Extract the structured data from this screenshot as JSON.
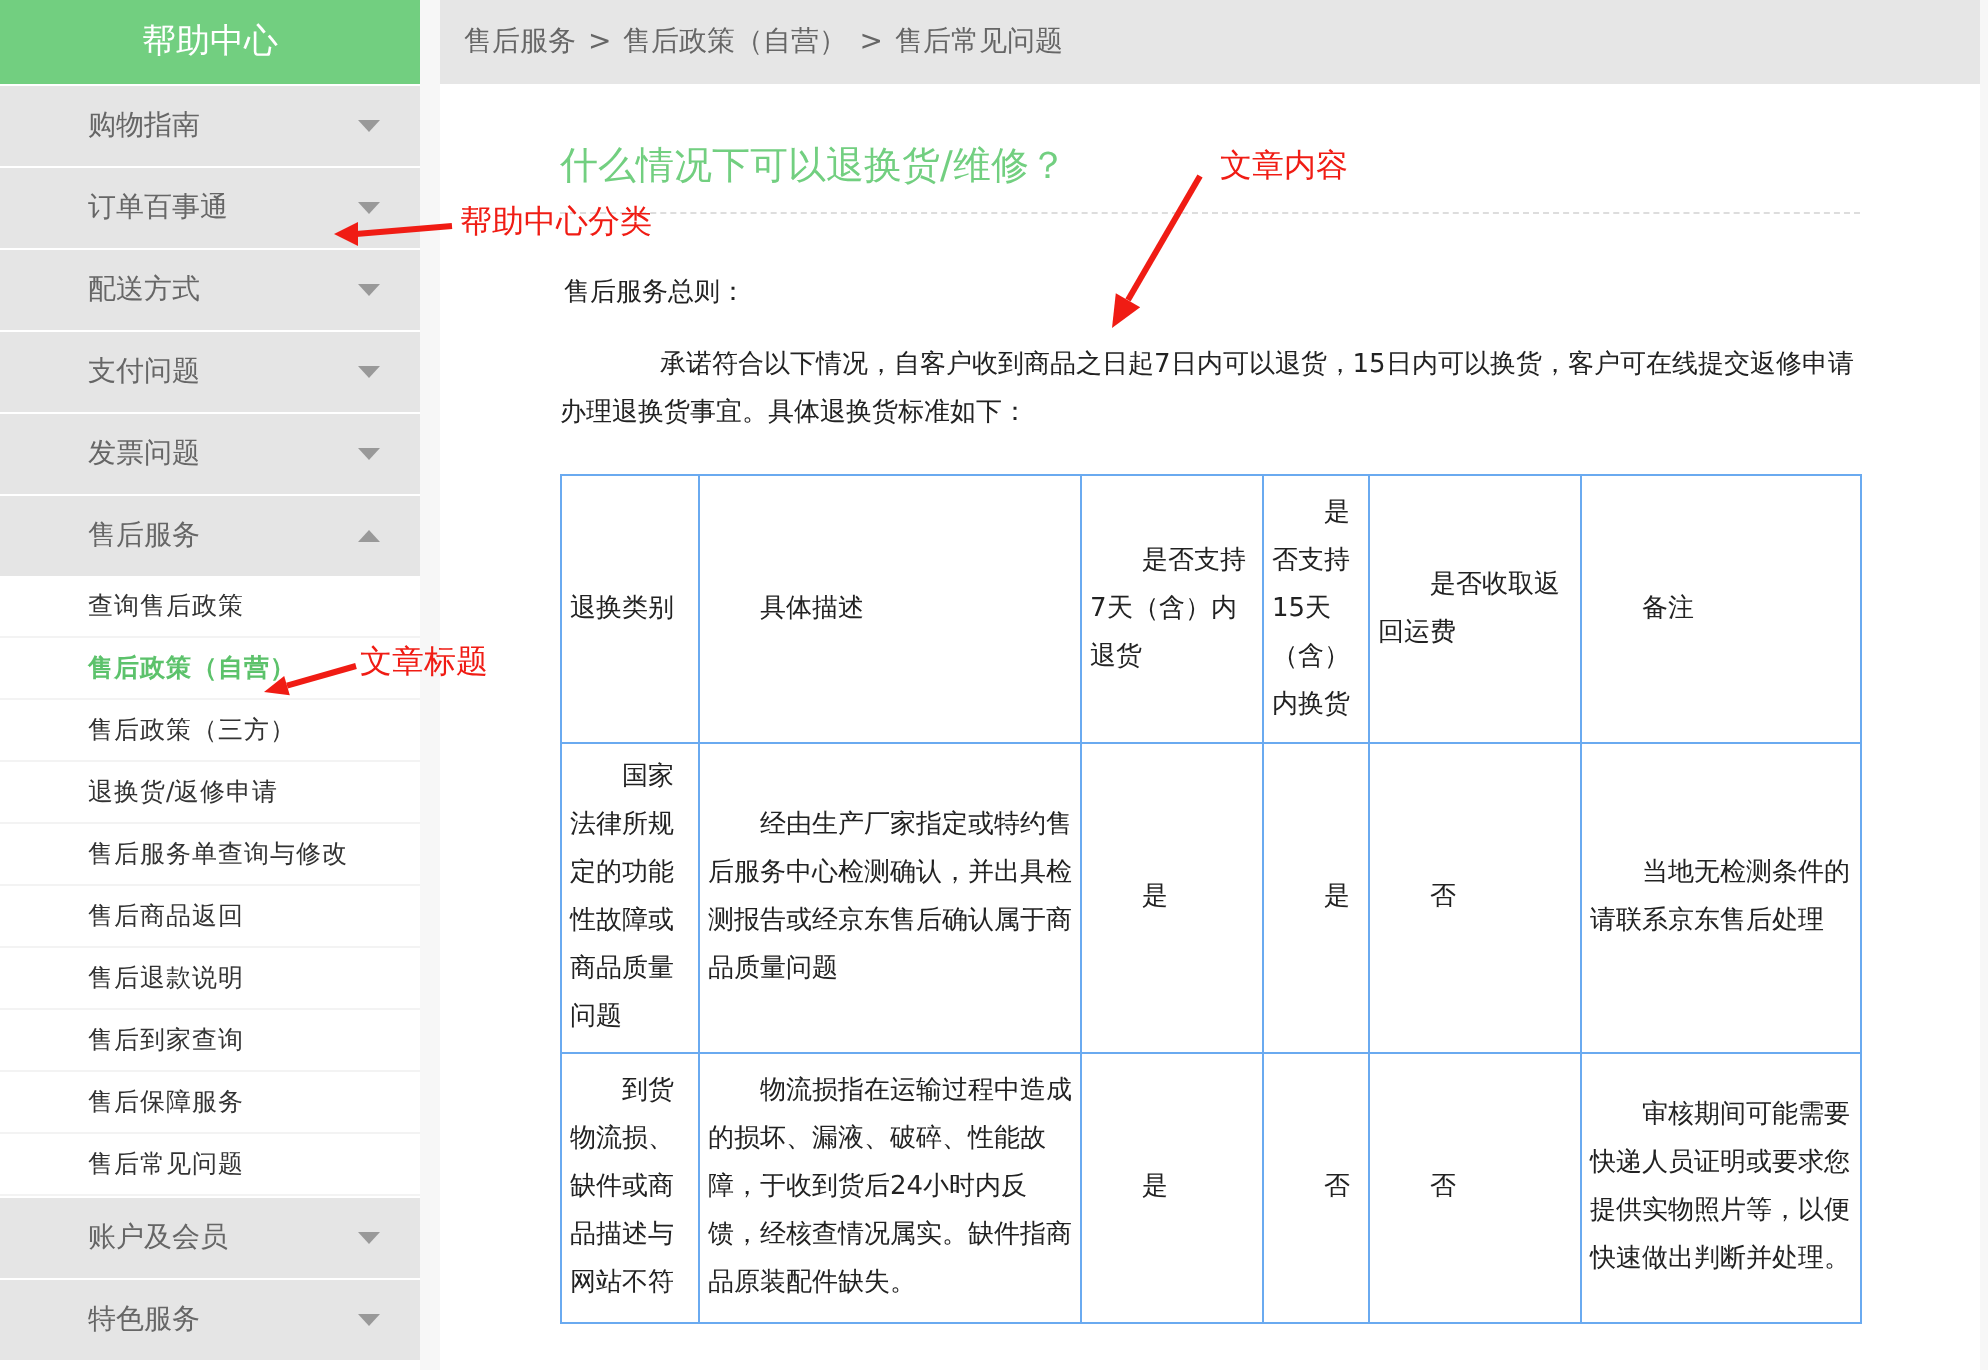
{
  "sidebar": {
    "title": "帮助中心",
    "categories": [
      {
        "label": "购物指南",
        "expanded": false
      },
      {
        "label": "订单百事通",
        "expanded": false
      },
      {
        "label": "配送方式",
        "expanded": false
      },
      {
        "label": "支付问题",
        "expanded": false
      },
      {
        "label": "发票问题",
        "expanded": false
      },
      {
        "label": "售后服务",
        "expanded": true,
        "children": [
          {
            "label": "查询售后政策",
            "selected": false
          },
          {
            "label": "售后政策（自营）",
            "selected": true
          },
          {
            "label": "售后政策（三方）",
            "selected": false
          },
          {
            "label": "退换货/返修申请",
            "selected": false
          },
          {
            "label": "售后服务单查询与修改",
            "selected": false
          },
          {
            "label": "售后商品返回",
            "selected": false
          },
          {
            "label": "售后退款说明",
            "selected": false
          },
          {
            "label": "售后到家查询",
            "selected": false
          },
          {
            "label": "售后保障服务",
            "selected": false
          },
          {
            "label": "售后常见问题",
            "selected": false
          }
        ]
      },
      {
        "label": "账户及会员",
        "expanded": false
      },
      {
        "label": "特色服务",
        "expanded": false
      }
    ]
  },
  "breadcrumb": {
    "separator": ">",
    "items": [
      "售后服务",
      "售后政策（自营）",
      "售后常见问题"
    ]
  },
  "article": {
    "title": "什么情况下可以退换货/维修？",
    "subheading": "售后服务总则：",
    "paragraph": "承诺符合以下情况，自客户收到商品之日起7日内可以退货，15日内可以换货，客户可在线提交返修申请办理退换货事宜。具体退换货标准如下：",
    "table": {
      "columns": [
        "退换类别",
        "具体描述",
        "是否支持7天（含）内退货",
        "是否支持15天（含）内换货",
        "是否收取返回运费",
        "备注"
      ],
      "rows": [
        [
          "国家法律所规定的功能性故障或商品质量问题",
          "经由生产厂家指定或特约售后服务中心检测确认，并出具检测报告或经京东售后确认属于商品质量问题",
          "是",
          "是",
          "否",
          "当地无检测条件的请联系京东售后处理"
        ],
        [
          "到货物流损、缺件或商品描述与网站不符",
          "物流损指在运输过程中造成的损坏、漏液、破碎、性能故障，于收到货后24小时内反馈，经核查情况属实。缺件指商品原装配件缺失。",
          "是",
          "否",
          "否",
          "审核期间可能需要快递人员证明或要求您提供实物照片等，以便快速做出判断并处理。"
        ]
      ]
    }
  },
  "annotations": [
    {
      "text": "帮助中心分类"
    },
    {
      "text": "文章标题"
    },
    {
      "text": "文章内容"
    }
  ]
}
